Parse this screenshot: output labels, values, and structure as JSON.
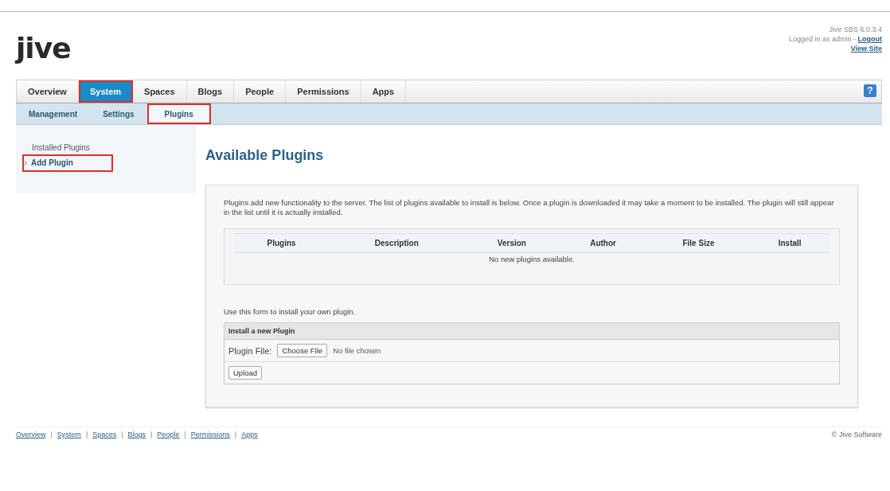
{
  "header": {
    "logo": "jive",
    "version": "Jive SBS 6.0.3.4",
    "login_text": "Logged in as admin - ",
    "logout": "Logout",
    "view_site": "View Site"
  },
  "tabs": [
    {
      "label": "Overview",
      "selected": false,
      "highlighted": false
    },
    {
      "label": "System",
      "selected": true,
      "highlighted": true
    },
    {
      "label": "Spaces",
      "selected": false,
      "highlighted": false
    },
    {
      "label": "Blogs",
      "selected": false,
      "highlighted": false
    },
    {
      "label": "People",
      "selected": false,
      "highlighted": false
    },
    {
      "label": "Permissions",
      "selected": false,
      "highlighted": false
    },
    {
      "label": "Apps",
      "selected": false,
      "highlighted": false
    }
  ],
  "help": "?",
  "subtabs": [
    {
      "label": "Management",
      "selected": false,
      "highlighted": false
    },
    {
      "label": "Settings",
      "selected": false,
      "highlighted": false
    },
    {
      "label": "Plugins",
      "selected": true,
      "highlighted": true
    }
  ],
  "sidebar": {
    "items": [
      {
        "label": "Installed Plugins",
        "selected": false,
        "highlighted": false
      },
      {
        "label": "Add Plugin",
        "selected": true,
        "highlighted": true
      }
    ]
  },
  "page_title": "Available Plugins",
  "intro": "Plugins add new functionality to the server. The list of plugins available to install is below. Once a plugin is downloaded it may take a moment to be installed. The plugin will still appear in the list until it is actually installed.",
  "table": {
    "columns": [
      "Plugins",
      "Description",
      "Version",
      "Author",
      "File Size",
      "Install"
    ],
    "empty_text": "No new plugins available."
  },
  "form_intro": "Use this form to install your own plugin.",
  "form": {
    "title": "Install a new Plugin",
    "field_label": "Plugin File:",
    "choose_button": "Choose File",
    "file_status": "No file chosen",
    "upload_button": "Upload"
  },
  "footer": {
    "links": [
      "Overview",
      "System",
      "Spaces",
      "Blogs",
      "People",
      "Permissions",
      "Apps"
    ],
    "separator": "|",
    "copyright": "© Jive Software"
  }
}
